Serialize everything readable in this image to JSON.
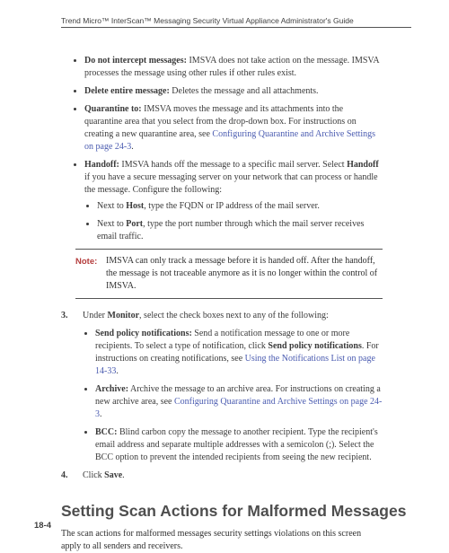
{
  "runningHead": "Trend Micro™ InterScan™ Messaging Security Virtual Appliance Administrator's Guide",
  "bullets": {
    "b1_bold": "Do not intercept messages:",
    "b1_rest": " IMSVA does not take action on the message. IMSVA processes the message using other rules if other rules exist.",
    "b2_bold": "Delete entire message:",
    "b2_rest": " Deletes the message and all attachments.",
    "b3_bold": "Quarantine to:",
    "b3_rest_a": " IMSVA moves the message and its attachments into the quarantine area that you select from the drop-down box. For instructions on creating a new quarantine area, see ",
    "b3_link": "Configuring Quarantine and Archive Settings on page 24-3",
    "b3_dot": ".",
    "b4_bold": "Handoff:",
    "b4_rest_a": " IMSVA hands off the message to a specific mail server. Select ",
    "b4_bold2": "Handoff",
    "b4_rest_b": " if you have a secure messaging server on your network that can process or handle the message. Configure the following:",
    "sub1_a": "Next to ",
    "sub1_bold": "Host",
    "sub1_b": ", type the FQDN or IP address of the mail server.",
    "sub2_a": "Next to ",
    "sub2_bold": "Port",
    "sub2_b": ", type the port number through which the mail server receives email traffic."
  },
  "note": {
    "label": "Note:",
    "text": "IMSVA can only track a message before it is handed off. After the handoff, the message is not traceable anymore as it is no longer within the control of IMSVA."
  },
  "step3": {
    "num": "3.",
    "a": "Under ",
    "bold": "Monitor",
    "b": ", select the check boxes next to any of the following:"
  },
  "step3sub": {
    "s1_bold": "Send policy notifications:",
    "s1_a": " Send a notification message to one or more recipients. To select a type of notification, click ",
    "s1_bold2": "Send policy notifications",
    "s1_b": ". For instructions on creating notifications, see ",
    "s1_link": "Using the Notifications List on page 14-33",
    "s1_dot": ".",
    "s2_bold": "Archive:",
    "s2_a": " Archive the message to an archive area. For instructions on creating a new archive area, see ",
    "s2_link": "Configuring Quarantine and Archive Settings on page 24-3",
    "s2_dot": ".",
    "s3_bold": "BCC:",
    "s3_a": " Blind carbon copy the message to another recipient. Type the recipient's email address and separate multiple addresses with a semicolon (;). Select the BCC option to prevent the intended recipients from seeing the new recipient."
  },
  "step4": {
    "num": "4.",
    "a": "Click ",
    "bold": "Save",
    "b": "."
  },
  "heading": "Setting Scan Actions for Malformed Messages",
  "intro": "The scan actions for malformed messages security settings violations on this screen apply to all senders and receivers.",
  "pageNum": "18-4"
}
